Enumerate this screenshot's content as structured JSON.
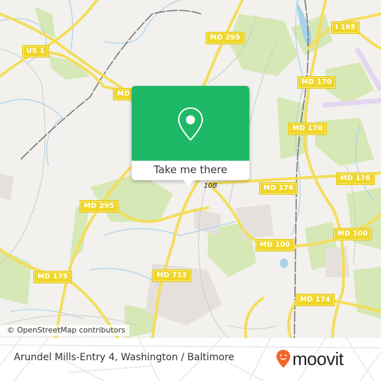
{
  "map": {
    "road_shields": [
      {
        "label": "US 1"
      },
      {
        "label": "MD"
      },
      {
        "label": "MD 295"
      },
      {
        "label": "I 195"
      },
      {
        "label": "MD 170"
      },
      {
        "label": "MD 170"
      },
      {
        "label": "MD 295"
      },
      {
        "label": "MD 176"
      },
      {
        "label": "MD 176"
      },
      {
        "label": "MD 100"
      },
      {
        "label": "MD 100"
      },
      {
        "label": "MD 175"
      },
      {
        "label": "MD 713"
      },
      {
        "label": "MD 174"
      }
    ],
    "exit_label": "10B",
    "attribution": "© OpenStreetMap contributors",
    "colors": {
      "land": "#f2f1ee",
      "park": "#d6e8b5",
      "road": "#f4dd5a",
      "water": "#a8d3ea",
      "rail": "#777777",
      "airport": "#e3d6f0"
    }
  },
  "popup": {
    "icon": "location-pin-icon",
    "cta_label": "Take me there",
    "color": "#1fb867"
  },
  "footer": {
    "title": "Arundel Mills-Entry 4, Washington / Baltimore",
    "brand": "moovit",
    "brand_color": "#f2662d"
  }
}
